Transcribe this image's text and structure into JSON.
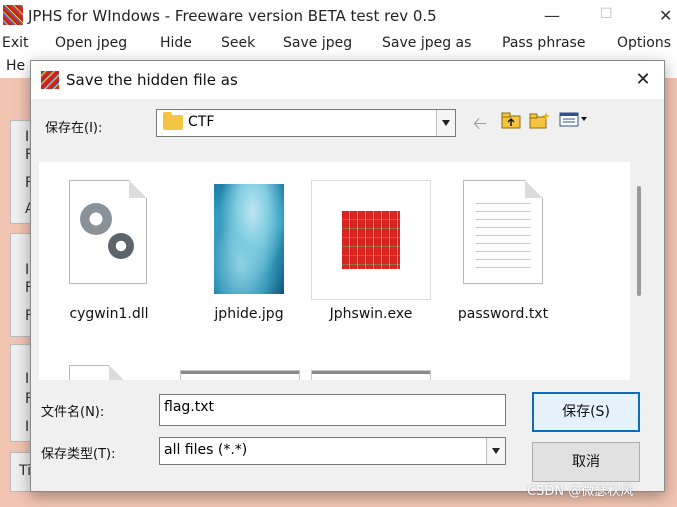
{
  "app": {
    "title": "JPHS for WIndows - Freeware version BETA test rev 0.5",
    "menu": [
      "Exit",
      "Open jpeg",
      "Hide",
      "Seek",
      "Save jpeg",
      "Save jpeg as",
      "Pass phrase",
      "Options"
    ],
    "menu2": "He",
    "panel_letters": [
      "I",
      "F",
      "F",
      "A",
      "I",
      "F",
      "F",
      "I",
      "F",
      "I",
      "Ti"
    ]
  },
  "dialog": {
    "title": "Save the hidden file as",
    "save_in_label": "保存在(I):",
    "save_in_value": "CTF",
    "files": [
      {
        "name": "cygwin1.dll",
        "icon": "dll-gear-icon"
      },
      {
        "name": "jphide.jpg",
        "icon": "jpeg-thumbnail"
      },
      {
        "name": "Jphswin.exe",
        "icon": "exe-icon"
      },
      {
        "name": "password.txt",
        "icon": "text-file-icon"
      }
    ],
    "filename_label": "文件名(N):",
    "filename_value": "flag.txt",
    "filetype_label": "保存类型(T):",
    "filetype_value": "all files (*.*)",
    "save_button": "保存(S)",
    "cancel_button": "取消"
  },
  "watermark": "CSDN @微瑟秋风"
}
